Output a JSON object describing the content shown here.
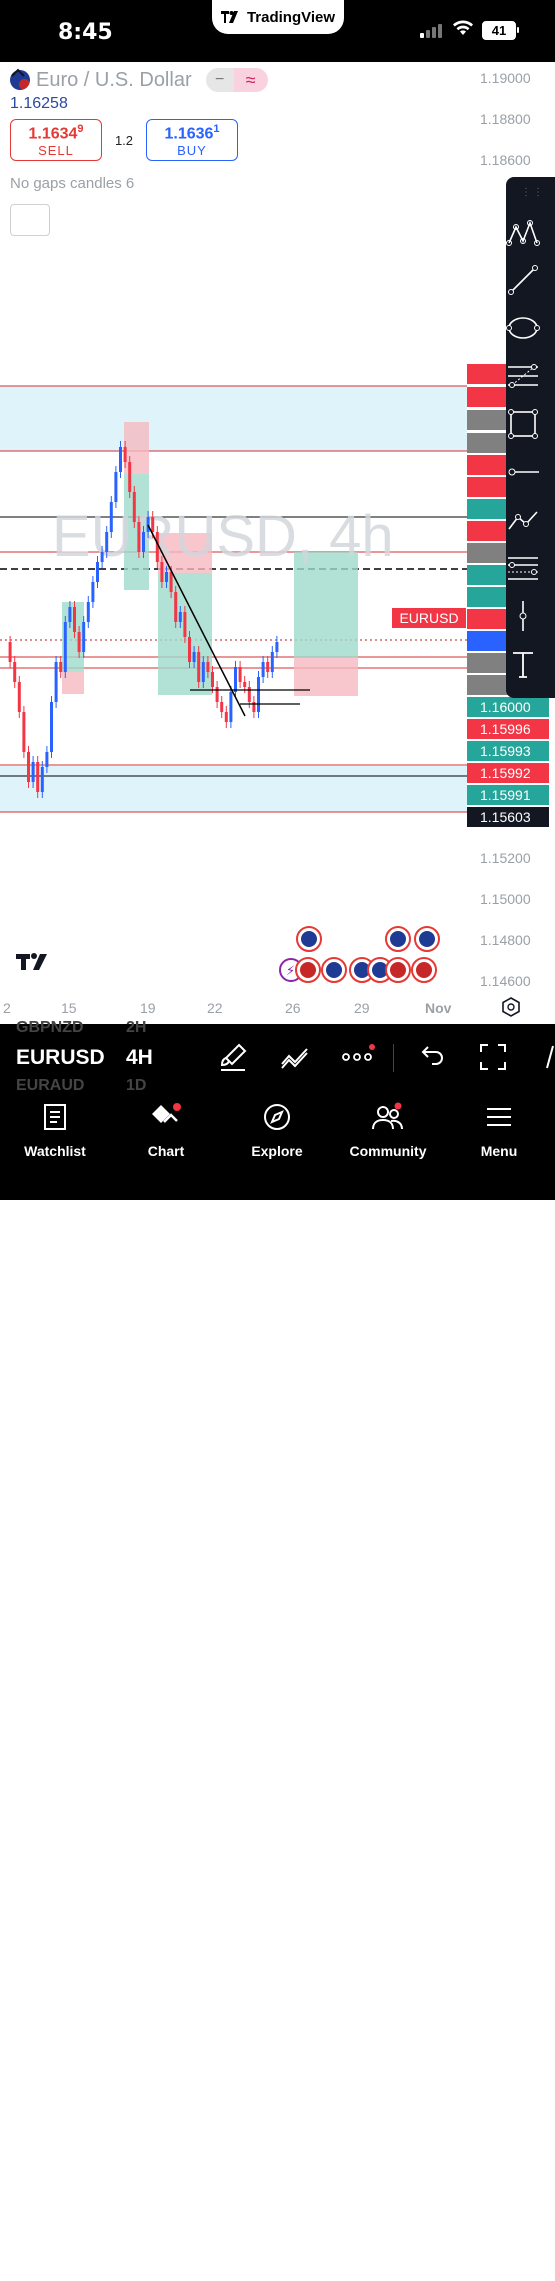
{
  "status_bar": {
    "time": "8:45",
    "battery": "41",
    "app_badge": "TradingView"
  },
  "header": {
    "pair_name": "Euro / U.S. Dollar",
    "last_price": "1.16258",
    "sell": {
      "price_main": "1.1634",
      "price_sup": "9",
      "label": "SELL"
    },
    "buy": {
      "price_main": "1.1636",
      "price_sup": "1",
      "label": "BUY"
    },
    "spread": "1.2",
    "indicator_label": "No gaps candles 6"
  },
  "watermark": "EURUSD, 4h",
  "symbol_tag": "EURUSD",
  "price_ticks": [
    "1.19000",
    "1.18800",
    "1.18600",
    "1.15200",
    "1.15000",
    "1.14800",
    "1.14600"
  ],
  "price_labels": [
    {
      "text": "1.16000",
      "color": "#26a69a"
    },
    {
      "text": "1.15996",
      "color": "#f23645"
    },
    {
      "text": "1.15993",
      "color": "#26a69a"
    },
    {
      "text": "1.15992",
      "color": "#f23645"
    },
    {
      "text": "1.15991",
      "color": "#26a69a"
    },
    {
      "text": "1.15603",
      "color": "#131722"
    }
  ],
  "date_ticks": [
    "2",
    "15",
    "19",
    "22",
    "26",
    "29",
    "Nov"
  ],
  "colors": {
    "up": "#2962ff",
    "down": "#f23645",
    "zone_blue": "#dff3fb",
    "zone_green": "#9fd9cc",
    "zone_red": "#f5b9c0"
  },
  "symbol_bar": {
    "symbol": "EURUSD",
    "timeframe": "4H",
    "ghost_above": "GBPNZD",
    "ghost_above_tf": "2H",
    "ghost_below": "EURAUD",
    "ghost_below_tf": "1D"
  },
  "tabs": [
    {
      "label": "Watchlist",
      "icon": "watchlist-icon"
    },
    {
      "label": "Chart",
      "icon": "chart-icon"
    },
    {
      "label": "Explore",
      "icon": "explore-icon"
    },
    {
      "label": "Community",
      "icon": "community-icon"
    },
    {
      "label": "Menu",
      "icon": "menu-icon"
    }
  ],
  "drawing_tools": [
    "pattern-icon",
    "trend-line-icon",
    "ellipse-icon",
    "fib-retracement-icon",
    "rectangle-icon",
    "horizontal-ray-icon",
    "path-icon",
    "fib-channel-icon",
    "vertical-line-icon",
    "text-tool-icon"
  ]
}
